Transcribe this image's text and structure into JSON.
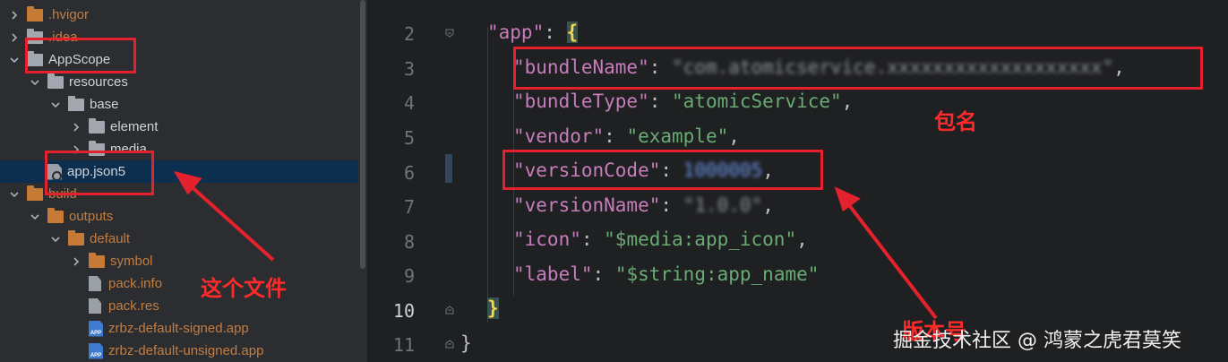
{
  "tree": [
    {
      "label": ".hvigor",
      "indent": 0,
      "chev": "right",
      "icon": "folder-orange",
      "color": "orange"
    },
    {
      "label": ".idea",
      "indent": 0,
      "chev": "right",
      "icon": "folder-grey",
      "color": "orange"
    },
    {
      "label": "AppScope",
      "indent": 0,
      "chev": "down",
      "icon": "folder-grey",
      "color": "normal"
    },
    {
      "label": "resources",
      "indent": 1,
      "chev": "down",
      "icon": "folder-grey",
      "color": "normal"
    },
    {
      "label": "base",
      "indent": 2,
      "chev": "down",
      "icon": "folder-grey",
      "color": "normal"
    },
    {
      "label": "element",
      "indent": 3,
      "chev": "right",
      "icon": "folder-grey",
      "color": "normal"
    },
    {
      "label": "media",
      "indent": 3,
      "chev": "right",
      "icon": "folder-grey",
      "color": "normal"
    },
    {
      "label": "app.json5",
      "indent": 1,
      "chev": "none",
      "icon": "json",
      "color": "normal",
      "selected": true
    },
    {
      "label": "build",
      "indent": 0,
      "chev": "down",
      "icon": "folder-orange",
      "color": "orange"
    },
    {
      "label": "outputs",
      "indent": 1,
      "chev": "down",
      "icon": "folder-orange",
      "color": "orange"
    },
    {
      "label": "default",
      "indent": 2,
      "chev": "down",
      "icon": "folder-orange",
      "color": "orange"
    },
    {
      "label": "symbol",
      "indent": 3,
      "chev": "right",
      "icon": "folder-orange",
      "color": "orange"
    },
    {
      "label": "pack.info",
      "indent": 3,
      "chev": "none",
      "icon": "file",
      "color": "orange"
    },
    {
      "label": "pack.res",
      "indent": 3,
      "chev": "none",
      "icon": "file",
      "color": "orange"
    },
    {
      "label": "zrbz-default-signed.app",
      "indent": 3,
      "chev": "none",
      "icon": "app",
      "color": "orange"
    },
    {
      "label": "zrbz-default-unsigned.app",
      "indent": 3,
      "chev": "none",
      "icon": "app",
      "color": "orange"
    }
  ],
  "editor": {
    "line_numbers": [
      "2",
      "3",
      "4",
      "5",
      "6",
      "7",
      "8",
      "9",
      "10",
      "11"
    ],
    "current_line": "10",
    "code": {
      "l2_key": "\"app\"",
      "l2_sep": ": ",
      "l2_brace": "{",
      "l3_key": "\"bundleName\"",
      "l3_sep": ": ",
      "l3_val": "\"com.atomicservice.xxxxxxxxxxxxxxxxxxx\"",
      "l3_end": ",",
      "l4_key": "\"bundleType\"",
      "l4_sep": ": ",
      "l4_val": "\"atomicService\"",
      "l4_end": ",",
      "l5_key": "\"vendor\"",
      "l5_sep": ": ",
      "l5_val": "\"example\"",
      "l5_end": ",",
      "l6_key": "\"versionCode\"",
      "l6_sep": ": ",
      "l6_val": "1000005",
      "l6_end": ",",
      "l7_key": "\"versionName\"",
      "l7_sep": ": ",
      "l7_val": "\"1.0.0\"",
      "l7_end": ",",
      "l8_key": "\"icon\"",
      "l8_sep": ": ",
      "l8_val": "\"$media:app_icon\"",
      "l8_end": ",",
      "l9_key": "\"label\"",
      "l9_sep": ": ",
      "l9_val": "\"$string:app_name\"",
      "l10_brace": "}",
      "l11_brace": "}"
    }
  },
  "annotations": {
    "this_file": "这个文件",
    "package_name": "包名",
    "version_number": "版本号",
    "color": "#e3222d"
  },
  "watermark": "掘金技术社区 @ 鸿蒙之虎君莫笑"
}
